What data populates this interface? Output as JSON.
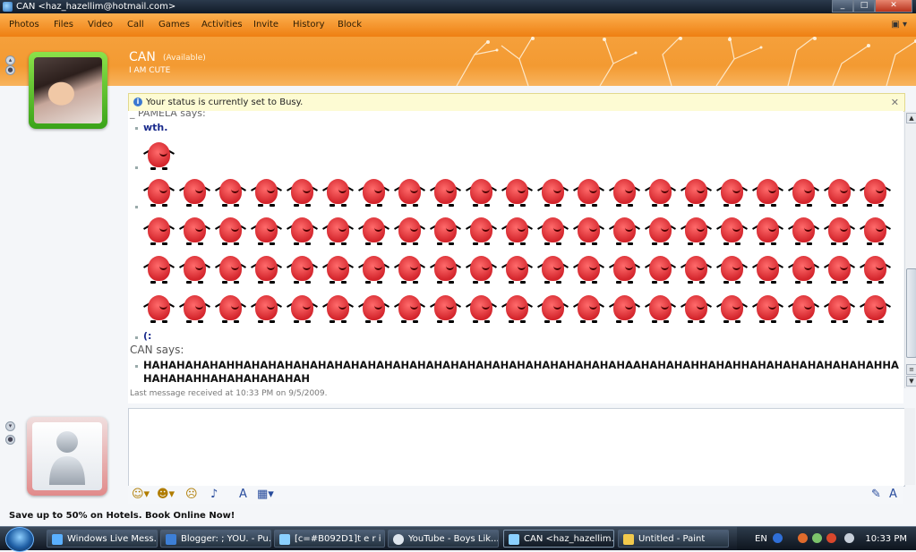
{
  "window": {
    "title": "CAN <haz_hazellim@hotmail.com>",
    "controls": [
      "_",
      "□",
      "✕"
    ]
  },
  "menu": {
    "items": [
      "Photos",
      "Files",
      "Video",
      "Call",
      "Games",
      "Activities",
      "Invite",
      "History",
      "Block"
    ]
  },
  "contact": {
    "name": "CAN",
    "status": "(Available)",
    "personal_message": "I AM CUTE"
  },
  "infobar": {
    "text": "Your status is currently set to Busy.",
    "close": "✕"
  },
  "conversation": {
    "cut_label": "_ PAMELA says:",
    "msg1": "wth.",
    "msg2": "(:",
    "sender2": "CAN says:",
    "big_message": "HAHAHAHAHAHHAHAHAHAHAHAHAHAHAHAHAHAHAHAHAHAHAHAHAHAHAHAHAHAAHAHAHAHHAHAHHAHAHAHAHAHAHAHAHHAHAHAHAHHAHAHAHAHAHAH",
    "last_received": "Last message received at 10:33 PM on 9/5/2009."
  },
  "ad": {
    "text": "Save up to 50% on Hotels. Book Online Now!"
  },
  "taskbar": {
    "items": [
      "Windows Live Mess...",
      "Blogger: ; YOU. - Pu...",
      "[c=#B092D1]t e r i , ...",
      "YouTube - Boys Lik...",
      "CAN <haz_hazellim...",
      "Untitled - Paint"
    ],
    "lang": "EN",
    "clock": "10:33 PM"
  },
  "colors": {
    "accent": "#f39a32",
    "menu": "#ee7f12",
    "emoticon": "#d4262d",
    "buddy_frame": "#3aa319"
  }
}
